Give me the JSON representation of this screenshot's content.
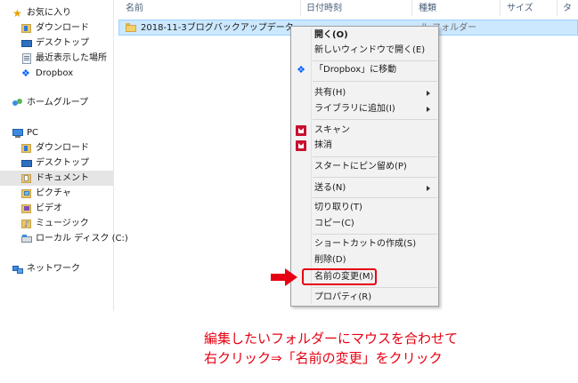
{
  "nav": {
    "items": [
      {
        "label": "お気に入り",
        "icon": "star-icon"
      },
      {
        "label": "ダウンロード",
        "icon": "downloads-folder-icon"
      },
      {
        "label": "デスクトップ",
        "icon": "desktop-icon"
      },
      {
        "label": "最近表示した場所",
        "icon": "recent-places-icon"
      },
      {
        "label": "Dropbox",
        "icon": "dropbox-icon"
      },
      {
        "label": "ホームグループ",
        "icon": "homegroup-icon"
      },
      {
        "label": "PC",
        "icon": "pc-icon"
      },
      {
        "label": "ダウンロード",
        "icon": "downloads-folder-icon"
      },
      {
        "label": "デスクトップ",
        "icon": "desktop-folder-icon"
      },
      {
        "label": "ドキュメント",
        "icon": "documents-folder-icon"
      },
      {
        "label": "ピクチャ",
        "icon": "pictures-folder-icon"
      },
      {
        "label": "ビデオ",
        "icon": "videos-folder-icon"
      },
      {
        "label": "ミュージック",
        "icon": "music-folder-icon"
      },
      {
        "label": "ローカル ディスク (C:)",
        "icon": "local-disk-icon"
      },
      {
        "label": "ネットワーク",
        "icon": "network-icon"
      }
    ]
  },
  "columns": {
    "name": "名前",
    "date": "日付時刻",
    "type": "種類",
    "size": "サイズ",
    "extra": "タ"
  },
  "file": {
    "name": "2018-11-3ブログバックアップデータ",
    "type": "ル フォルダー"
  },
  "context_menu": {
    "open": "開く(O)",
    "open_new_window": "新しいウィンドウで開く(E)",
    "dropbox_move": "「Dropbox」に移動",
    "share": "共有(H)",
    "add_to_library": "ライブラリに追加(I)",
    "scan": "スキャン",
    "shred": "抹消",
    "pin_to_start": "スタートにピン留め(P)",
    "send_to": "送る(N)",
    "cut": "切り取り(T)",
    "copy": "コピー(C)",
    "create_shortcut": "ショートカットの作成(S)",
    "delete": "削除(D)",
    "rename": "名前の変更(M)",
    "properties": "プロパティ(R)"
  },
  "annotation": {
    "line1": "編集したいフォルダーにマウスを合わせて",
    "line2": "右クリック⇒「名前の変更」をクリック",
    "highlight_color": "#e60012"
  }
}
